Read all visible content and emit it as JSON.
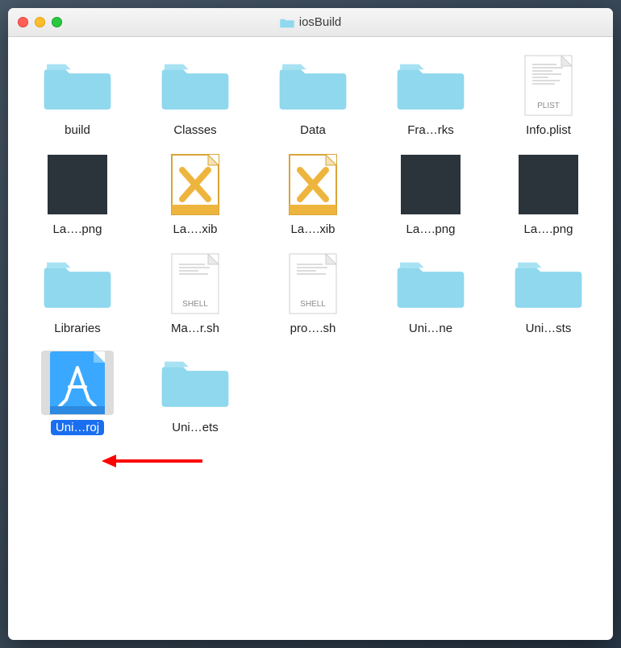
{
  "window": {
    "title": "iosBuild"
  },
  "items": [
    {
      "name": "build",
      "type": "folder"
    },
    {
      "name": "Classes",
      "type": "folder"
    },
    {
      "name": "Data",
      "type": "folder"
    },
    {
      "name": "Fra…rks",
      "type": "folder"
    },
    {
      "name": "Info.plist",
      "type": "plist"
    },
    {
      "name": "La….png",
      "type": "png-dark"
    },
    {
      "name": "La….xib",
      "type": "xib"
    },
    {
      "name": "La….xib",
      "type": "xib"
    },
    {
      "name": "La….png",
      "type": "png-dark"
    },
    {
      "name": "La….png",
      "type": "png-dark"
    },
    {
      "name": "Libraries",
      "type": "folder"
    },
    {
      "name": "Ma…r.sh",
      "type": "shell"
    },
    {
      "name": "pro….sh",
      "type": "shell"
    },
    {
      "name": "Uni…ne",
      "type": "folder"
    },
    {
      "name": "Uni…sts",
      "type": "folder"
    },
    {
      "name": "Uni…roj",
      "type": "xcodeproj",
      "selected": true
    },
    {
      "name": "Uni…ets",
      "type": "folder"
    }
  ],
  "iconTags": {
    "plist": "PLIST",
    "shell": "SHELL"
  }
}
